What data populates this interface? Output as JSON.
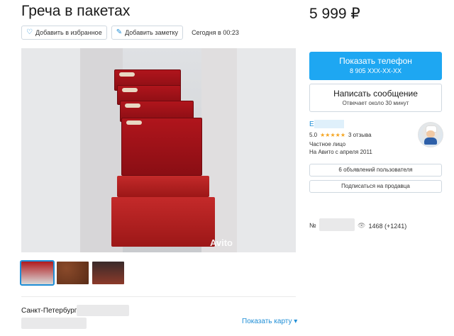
{
  "listing": {
    "title": "Греча в пакетах",
    "price": "5 999 ₽",
    "posted": "Сегодня в 00:23",
    "favorite_label": "Добавить в избранное",
    "note_label": "Добавить заметку",
    "photo_watermark": "Avito",
    "city": "Санкт-Петербург",
    "map_link": "Показать карту",
    "ad_number_label": "№",
    "views": "1468 (+1241)"
  },
  "contact": {
    "phone_button": "Показать телефон",
    "phone_masked": "8 905 XXX-XX-XX",
    "message_button": "Написать сообщение",
    "message_sub": "Отвечает около 30 минут"
  },
  "seller": {
    "name_initial": "Е",
    "rating": "5.0",
    "stars": "★★★★★",
    "reviews": "3 отзыва",
    "type": "Частное лицо",
    "since": "На Авито с апреля 2011",
    "ads_button": "6 объявлений пользователя",
    "subscribe_button": "Подписаться на продавца"
  },
  "icons": {
    "favorite": "heart-icon",
    "note": "note-icon",
    "views": "eye-icon",
    "map_chevron": "chevron-down-icon"
  },
  "colors": {
    "accent": "#1f8ed6",
    "phone_button": "#1ea7f2",
    "stars": "#f5a623"
  }
}
